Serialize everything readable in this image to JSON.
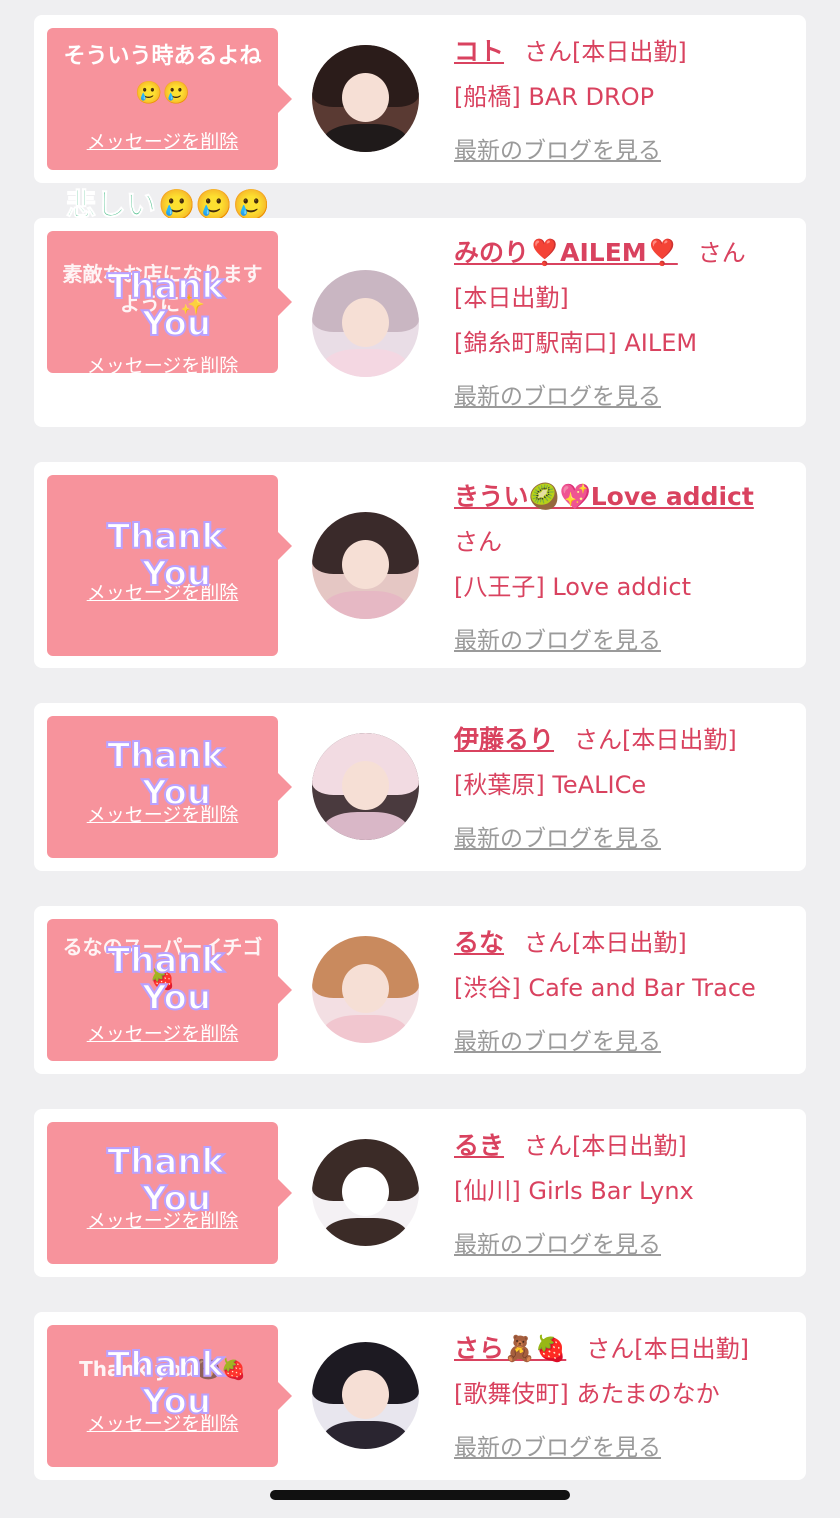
{
  "cards": [
    {
      "bubble_text": "そういう時あるよね🥲🥲",
      "delete_label": "メッセージを削除",
      "has_sticker": false,
      "name": "コト",
      "honorific": "さん",
      "status": "[本日出勤]",
      "location": "[船橋] BAR DROP",
      "blog_link": "最新のブログを見る"
    },
    {
      "bubble_text": "素敵なお店になりますように✨",
      "delete_label": "メッセージを削除",
      "has_sticker": true,
      "name": "みのり❣️AILEM❣️",
      "honorific": "さん",
      "status": "[本日出勤]",
      "location": "[錦糸町駅南口] AILEM",
      "blog_link": "最新のブログを見る"
    },
    {
      "bubble_text": "",
      "delete_label": "メッセージを削除",
      "has_sticker": true,
      "name": "きうい🥝💖Love addict",
      "honorific": "さん",
      "status": "",
      "location": "[八王子] Love addict",
      "blog_link": "最新のブログを見る"
    },
    {
      "bubble_text": "",
      "delete_label": "メッセージを削除",
      "has_sticker": true,
      "name": "伊藤るり",
      "honorific": "さん",
      "status": "[本日出勤]",
      "location": "[秋葉原] TeALICe",
      "blog_link": "最新のブログを見る"
    },
    {
      "bubble_text": "るなのスーパーイチゴ🍓",
      "delete_label": "メッセージを削除",
      "has_sticker": true,
      "name": "るな",
      "honorific": "さん",
      "status": "[本日出勤]",
      "location": "[渋谷] Cafe and Bar Trace",
      "blog_link": "最新のブログを見る"
    },
    {
      "bubble_text": "",
      "delete_label": "メッセージを削除",
      "has_sticker": true,
      "name": "るき",
      "honorific": "さん",
      "status": "[本日出勤]",
      "location": "[仙川] Girls Bar Lynx",
      "blog_link": "最新のブログを見る"
    },
    {
      "bubble_text": "Thank you🐻🍓",
      "delete_label": "メッセージを削除",
      "has_sticker": true,
      "name": "さら🧸🍓",
      "honorific": "さん",
      "status": "[本日出勤]",
      "location": "[歌舞伎町] あたまのなか",
      "blog_link": "最新のブログを見る"
    }
  ],
  "floating_sticker": {
    "text": "悲しい",
    "emoji": "🥲🥲🥲"
  },
  "sticker": {
    "line1": "Thank",
    "line2": "You"
  },
  "colors": {
    "background": "#efeff1",
    "bubble": "#f7939c",
    "accent": "#d9425f",
    "link_gray": "#9a9a9a"
  }
}
